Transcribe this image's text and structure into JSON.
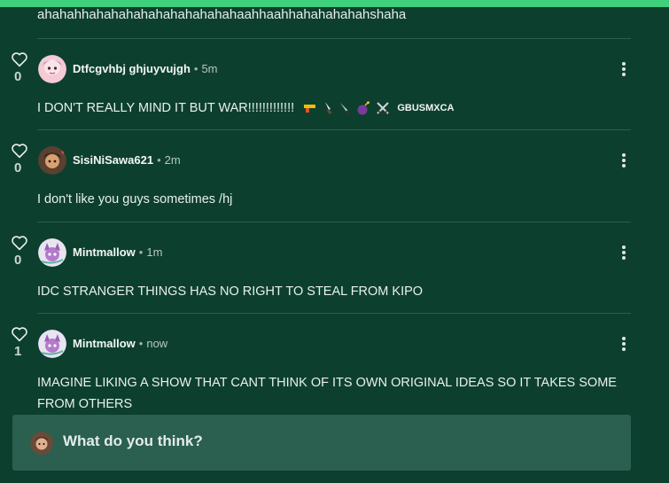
{
  "colors": {
    "background": "#0d3f2f",
    "accent_bar": "#3ed07a",
    "reply_box": "#2b5f50"
  },
  "truncated_text": "ahahahhahahahahahahahahahahaahhaahhahahahahahshaha",
  "comments": [
    {
      "likes": "0",
      "username": "Dtfcgvhbj ghjuyvujgh",
      "time": "5m",
      "text": "I DON'T REALLY MIND IT BUT WAR!!!!!!!!!!!!!",
      "tag": "GBUSMXCA",
      "icons": [
        "gun-icon",
        "knife-icon",
        "knife-icon",
        "bomb-icon",
        "crossed-swords-icon"
      ]
    },
    {
      "likes": "0",
      "username": "SisiNiSawa621",
      "time": "2m",
      "text": "I don't like you guys sometimes /hj"
    },
    {
      "likes": "0",
      "username": "Mintmallow",
      "time": "1m",
      "text": "IDC STRANGER THINGS HAS NO RIGHT TO STEAL FROM KIPO"
    },
    {
      "likes": "1",
      "username": "Mintmallow",
      "time": "now",
      "text": "IMAGINE LIKING A SHOW THAT CANT THINK OF ITS OWN ORIGINAL IDEAS SO IT TAKES SOME FROM OTHERS"
    }
  ],
  "reply": {
    "placeholder": "What do you think?"
  },
  "separator": "•"
}
